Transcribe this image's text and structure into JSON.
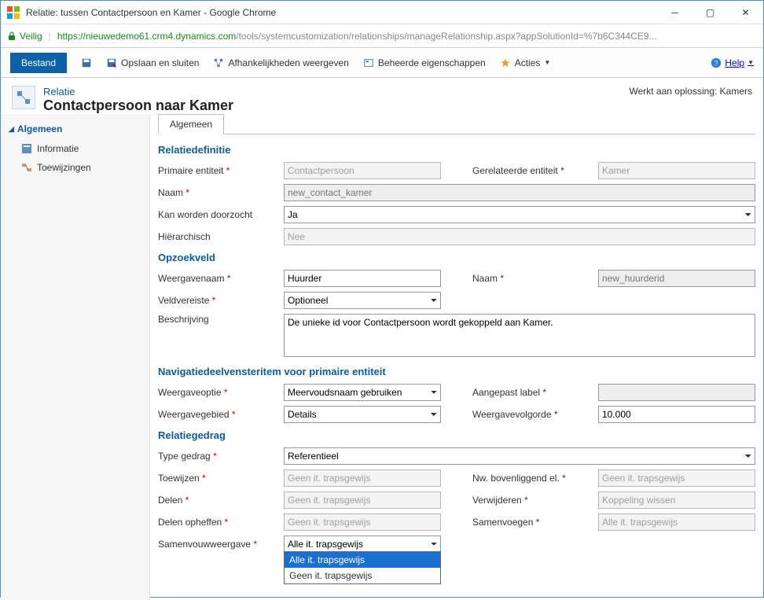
{
  "window": {
    "title": "Relatie: tussen Contactpersoon en Kamer - Google Chrome",
    "secure_label": "Veilig",
    "url_domain": "https://nieuwedemo61.crm4.dynamics.com",
    "url_path": "/tools/systemcustomization/relationships/manageRelationship.aspx?appSolutionId=%7b6C344CE9..."
  },
  "toolbar": {
    "file": "Bestand",
    "save_close": "Opslaan en sluiten",
    "dependencies": "Afhankelijkheden weergeven",
    "managed_props": "Beheerde eigenschappen",
    "actions": "Acties",
    "help": "Help"
  },
  "header": {
    "rel_label": "Relatie",
    "rel_name": "Contactpersoon naar Kamer",
    "working_on": "Werkt aan oplossing: Kamers"
  },
  "sidebar": {
    "general": "Algemeen",
    "info": "Informatie",
    "mappings": "Toewijzingen"
  },
  "tabs": {
    "general": "Algemeen"
  },
  "sections": {
    "reldef": "Relatiedefinitie",
    "lookup": "Opzoekveld",
    "navpane": "Navigatiedeelvensteritem voor primaire entiteit",
    "relbehavior": "Relatiegedrag"
  },
  "fields": {
    "primary_entity_label": "Primaire entiteit",
    "primary_entity_value": "Contactpersoon",
    "related_entity_label": "Gerelateerde entiteit",
    "related_entity_value": "Kamer",
    "name_label": "Naam",
    "name_value": "new_contact_kamer",
    "searchable_label": "Kan worden doorzocht",
    "searchable_value": "Ja",
    "hierarchical_label": "Hiërarchisch",
    "hierarchical_value": "Nee",
    "displayname_label": "Weergavenaam",
    "displayname_value": "Huurder",
    "lookup_name_label": "Naam",
    "lookup_name_value": "new_huurderid",
    "fieldreq_label": "Veldvereiste",
    "fieldreq_value": "Optioneel",
    "description_label": "Beschrijving",
    "description_value": "De unieke id voor Contactpersoon wordt gekoppeld aan Kamer.",
    "displayoption_label": "Weergaveoptie",
    "displayoption_value": "Meervoudsnaam gebruiken",
    "customlabel_label": "Aangepast label",
    "customlabel_value": "",
    "displayarea_label": "Weergavegebied",
    "displayarea_value": "Details",
    "displayorder_label": "Weergavevolgorde",
    "displayorder_value": "10.000",
    "behaviortype_label": "Type gedrag",
    "behaviortype_value": "Referentieel",
    "assign_label": "Toewijzen",
    "assign_value": "Geen it. trapsgewijs",
    "reparent_label": "Nw. bovenliggend el.",
    "reparent_value": "Geen it. trapsgewijs",
    "share_label": "Delen",
    "share_value": "Geen it. trapsgewijs",
    "delete_label": "Verwijderen",
    "delete_value": "Koppeling wissen",
    "unshare_label": "Delen opheffen",
    "unshare_value": "Geen it. trapsgewijs",
    "merge_label": "Samenvoegen",
    "merge_value": "Alle it. trapsgewijs",
    "rollupview_label": "Samenvouwweergave",
    "rollupview_value": "Alle it. trapsgewijs",
    "dropdown_opt1": "Alle it. trapsgewijs",
    "dropdown_opt2": "Geen it. trapsgewijs"
  }
}
